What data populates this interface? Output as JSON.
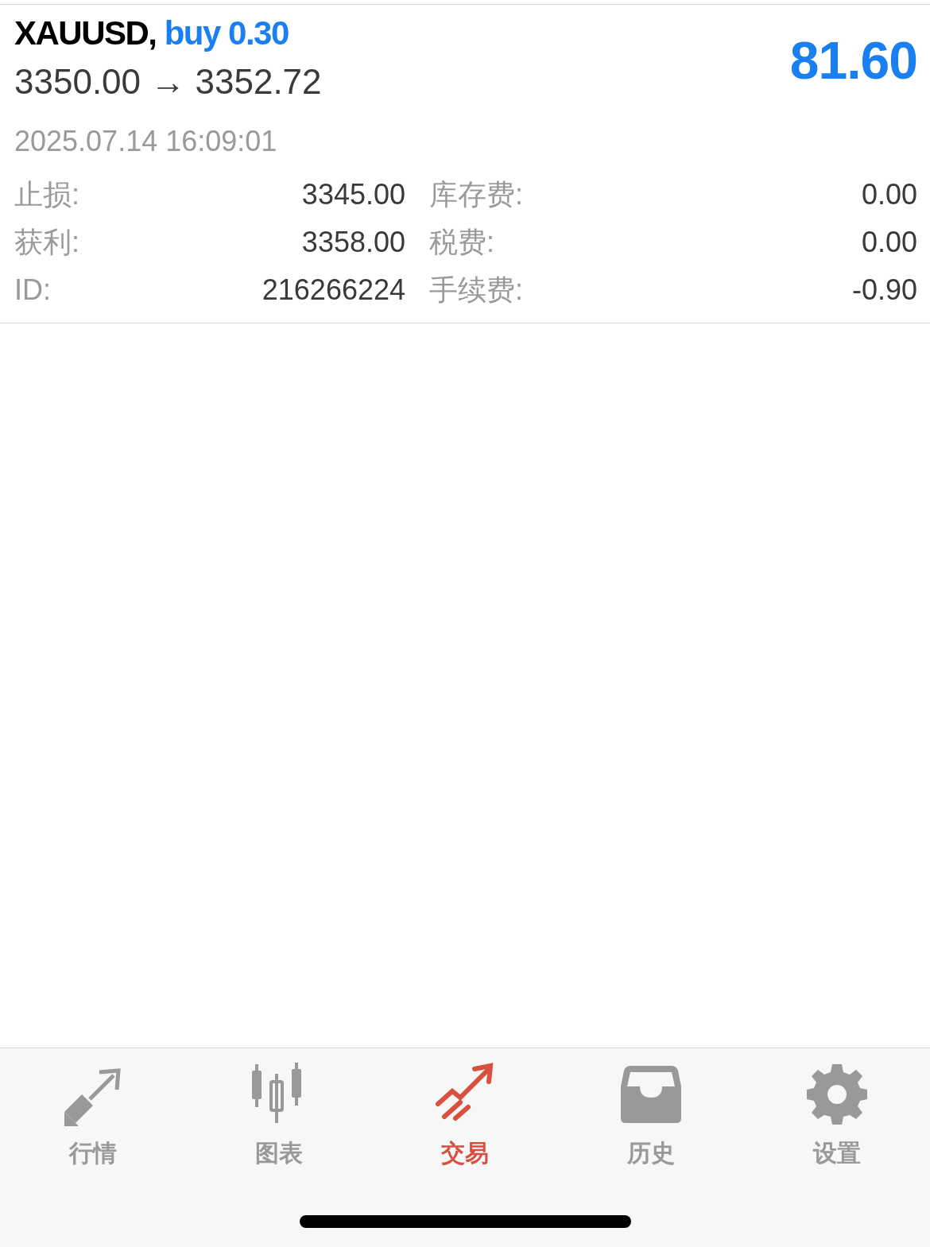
{
  "position": {
    "symbol": "XAUUSD,",
    "side": "buy 0.30",
    "prices": "3350.00 → 3352.72",
    "profit": "81.60",
    "time": "2025.07.14 16:09:01",
    "details": [
      {
        "label": "止损:",
        "value": "3345.00"
      },
      {
        "label": "库存费:",
        "value": "0.00"
      },
      {
        "label": "获利:",
        "value": "3358.00"
      },
      {
        "label": "税费:",
        "value": "0.00"
      },
      {
        "label": "ID:",
        "value": "216266224"
      },
      {
        "label": "手续费:",
        "value": "-0.90"
      }
    ]
  },
  "tab_bar": [
    {
      "kind": "quotes",
      "label": "行情",
      "selected": false
    },
    {
      "kind": "chart",
      "label": "图表",
      "selected": false
    },
    {
      "kind": "trade",
      "label": "交易",
      "selected": true
    },
    {
      "kind": "history",
      "label": "历史",
      "selected": false
    },
    {
      "kind": "settings",
      "label": "设置",
      "selected": false
    }
  ]
}
